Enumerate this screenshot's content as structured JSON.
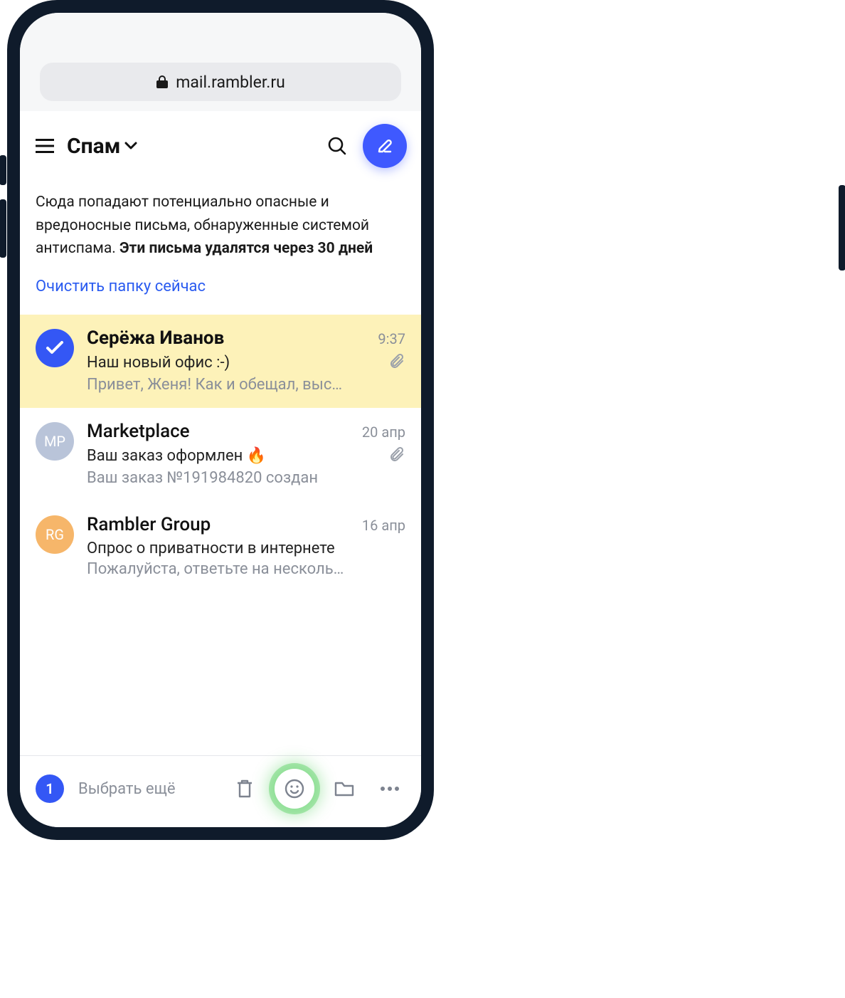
{
  "browser": {
    "url": "mail.rambler.ru"
  },
  "header": {
    "folder": "Спам"
  },
  "info": {
    "text_part1": "Сюда попадают потенциально опасные и вредоносные письма, обнаруженные системой антиспама. ",
    "text_bold": "Эти письма удалятся через 30 дней",
    "clear_link": "Очистить папку сейчас"
  },
  "messages": [
    {
      "selected": true,
      "avatar_type": "check",
      "avatar_text": "",
      "sender": "Серёжа Иванов",
      "date": "9:37",
      "subject": "Наш новый офис :-)",
      "has_attachment": true,
      "preview": "Привет, Женя! Как и обещал, выс…",
      "unread": true
    },
    {
      "selected": false,
      "avatar_type": "mp",
      "avatar_text": "MP",
      "sender": "Marketplace",
      "date": "20 апр",
      "subject": "Ваш заказ оформлен 🔥",
      "has_attachment": true,
      "preview": "Ваш заказ №191984820 создан",
      "unread": false
    },
    {
      "selected": false,
      "avatar_type": "rg",
      "avatar_text": "RG",
      "sender": "Rambler Group",
      "date": "16 апр",
      "subject": "Опрос о приватности в интернете",
      "has_attachment": false,
      "preview": "Пожалуйста, ответьте на несколь…",
      "unread": false
    }
  ],
  "bottom": {
    "selected_count": "1",
    "select_more": "Выбрать ещё"
  }
}
